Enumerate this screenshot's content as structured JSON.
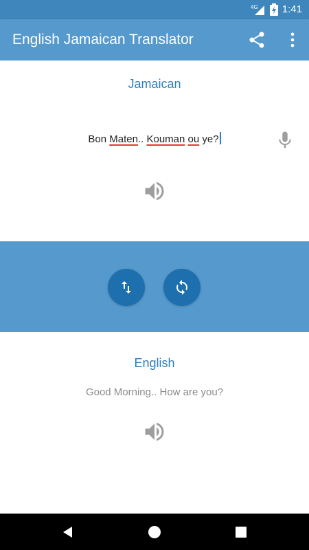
{
  "status_bar": {
    "network_label": "4G",
    "time": "1:41",
    "icons": [
      "signal-icon",
      "battery-charging-icon"
    ]
  },
  "app_bar": {
    "title": "English Jamaican Translator",
    "actions": [
      "share-icon",
      "more-options-icon"
    ]
  },
  "source": {
    "language": "Jamaican",
    "text_parts": [
      {
        "text": "Bon ",
        "misspelled": false
      },
      {
        "text": "Maten",
        "misspelled": true
      },
      {
        "text": ".. ",
        "misspelled": false
      },
      {
        "text": "Kouman",
        "misspelled": true
      },
      {
        "text": " ",
        "misspelled": false
      },
      {
        "text": "ou",
        "misspelled": true
      },
      {
        "text": " ye?",
        "misspelled": false
      }
    ],
    "icons": [
      "microphone-icon",
      "speaker-icon"
    ]
  },
  "controls": {
    "icons": [
      "swap-languages-icon",
      "refresh-icon"
    ]
  },
  "target": {
    "language": "English",
    "text": "Good Morning.. How are you?",
    "icons": [
      "speaker-icon"
    ]
  },
  "navigation": {
    "icons": [
      "back-icon",
      "home-icon",
      "recents-icon"
    ]
  },
  "colors": {
    "app_bar": "#5599cd",
    "status_bar": "#3f86bd",
    "accent": "#2d7fbe",
    "fab": "#1d6fae",
    "icon_grey": "#9e9e9e",
    "output_text": "#8a8a8a"
  }
}
